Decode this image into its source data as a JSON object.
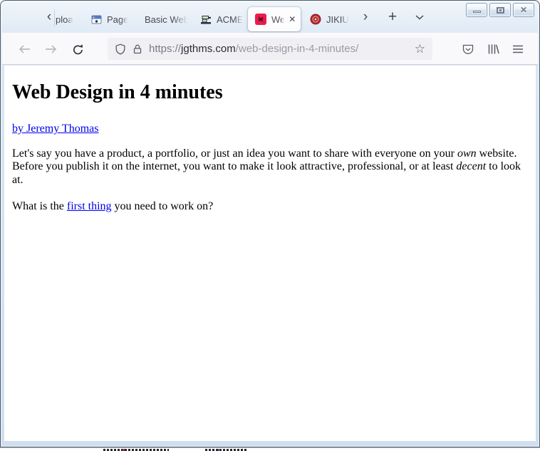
{
  "colors": {
    "active_tab_favicon": "#ed1a4b",
    "jikiu_favicon": "#b5272b",
    "link": "#0000ee"
  },
  "titlebar": {
    "scroll_left_glyph": "‹",
    "scroll_right_glyph": "›",
    "new_tab_glyph": "+",
    "tabs": [
      {
        "label": "ploa"
      },
      {
        "label": "Page"
      },
      {
        "label": "Basic Web"
      },
      {
        "label": "ACME"
      },
      {
        "label": "We",
        "active": true,
        "close_glyph": "✕"
      },
      {
        "label": "JIKIU"
      }
    ],
    "window_controls": {
      "close_glyph": "✕"
    }
  },
  "navbar": {
    "url": {
      "protocol": "https://",
      "domain": "jgthms.com",
      "path": "/web-design-in-4-minutes/"
    }
  },
  "page": {
    "title": "Web Design in 4 minutes",
    "byline": {
      "text": "by Jeremy Thomas"
    },
    "intro_segments": [
      {
        "text": "Let's say you have a product, a portfolio, or just an idea you want to share with everyone on your "
      },
      {
        "text": "own",
        "style": "italic"
      },
      {
        "text": " website. Before you publish it on the internet, you want to make it look attractive, professional, or at least "
      },
      {
        "text": "decent",
        "style": "italic"
      },
      {
        "text": " to look at."
      }
    ],
    "question_segments": [
      {
        "text": "What is the "
      },
      {
        "text": "first thing",
        "style": "link"
      },
      {
        "text": " you need to work on?"
      }
    ]
  }
}
